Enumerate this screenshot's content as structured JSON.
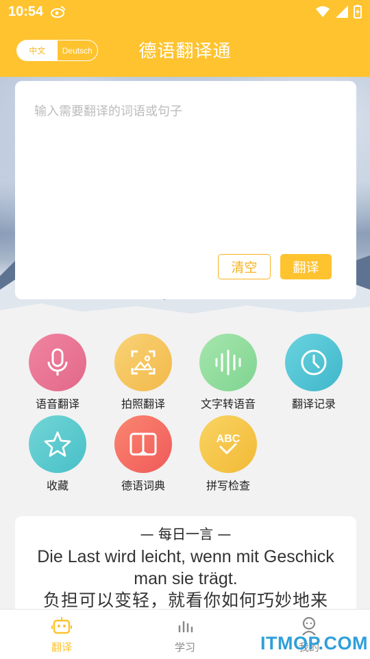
{
  "status_bar": {
    "time": "10:54"
  },
  "header": {
    "title": "德语翻译通",
    "lang_toggle": {
      "left": "中文",
      "right": "Deutsch"
    }
  },
  "input_card": {
    "placeholder": "输入需要翻译的词语或句子",
    "clear_label": "清空",
    "translate_label": "翻译"
  },
  "features": [
    {
      "label": "语音翻译",
      "icon": "microphone-icon",
      "color": "#e97595"
    },
    {
      "label": "拍照翻译",
      "icon": "photo-scan-icon",
      "color": "#f6c45c"
    },
    {
      "label": "文字转语音",
      "icon": "sound-wave-icon",
      "color": "#8cdc9a"
    },
    {
      "label": "翻译记录",
      "icon": "clock-icon",
      "color": "#56c6d6"
    },
    {
      "label": "收藏",
      "icon": "star-icon",
      "color": "#5ccacf"
    },
    {
      "label": "德语词典",
      "icon": "book-icon",
      "color": "#f56a62"
    },
    {
      "label": "拼写检查",
      "icon": "abc-check-icon",
      "color": "#f6c64b"
    }
  ],
  "daily_quote": {
    "heading": "— 每日一言 —",
    "german": "Die Last wird leicht, wenn mit Geschick man sie trägt.",
    "chinese": "负担可以变轻，就看你如何巧妙地来"
  },
  "tabbar": {
    "tabs": [
      {
        "label": "翻译",
        "active": true
      },
      {
        "label": "学习",
        "active": false
      },
      {
        "label": "我的",
        "active": false
      }
    ]
  },
  "watermark": "ITMOP.COM",
  "colors": {
    "brand_yellow": "#fec32f",
    "accent_orange": "#f6b21b"
  }
}
